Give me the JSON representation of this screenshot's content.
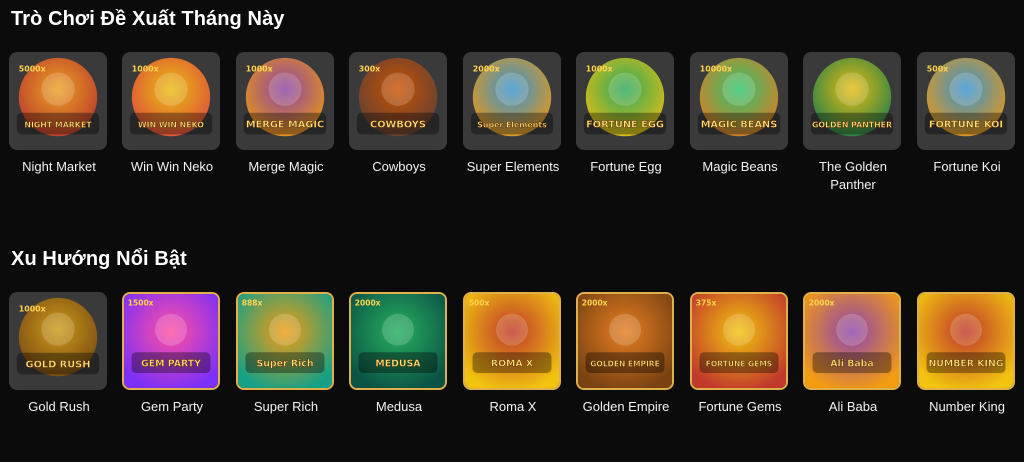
{
  "sections": [
    {
      "title": "Trò Chơi Đề Xuất Tháng Này",
      "games": [
        {
          "name": "Night Market",
          "logo": "NIGHT MARKET",
          "mult": "5000x",
          "colors": [
            "#f5a623",
            "#c0392b"
          ],
          "icon": "night-market-art"
        },
        {
          "name": "Win Win Neko",
          "logo": "WIN WIN NEKO",
          "mult": "1000x",
          "colors": [
            "#f1c40f",
            "#e74c3c"
          ],
          "icon": "neko-cat-art"
        },
        {
          "name": "Merge Magic",
          "logo": "MERGE MAGIC",
          "mult": "1000x",
          "colors": [
            "#8e44ad",
            "#f39c12"
          ],
          "icon": "merge-magic-art"
        },
        {
          "name": "Cowboys",
          "logo": "COWBOYS",
          "mult": "300x",
          "colors": [
            "#d35400",
            "#5d4037"
          ],
          "icon": "cowboys-art"
        },
        {
          "name": "Super Elements",
          "logo": "Super Elements",
          "mult": "2000x",
          "colors": [
            "#3498db",
            "#f39c12"
          ],
          "icon": "super-elements-art"
        },
        {
          "name": "Fortune Egg",
          "logo": "FORTUNE EGG",
          "mult": "1000x",
          "colors": [
            "#27ae60",
            "#f1c40f"
          ],
          "icon": "fortune-egg-art"
        },
        {
          "name": "Magic Beans",
          "logo": "MAGIC BEANS",
          "mult": "10000x",
          "colors": [
            "#2ecc71",
            "#e67e22"
          ],
          "icon": "magic-beans-art"
        },
        {
          "name": "The Golden Panther",
          "logo": "GOLDEN PANTHER",
          "mult": "",
          "colors": [
            "#f1c40f",
            "#1e824c"
          ],
          "icon": "golden-panther-art"
        },
        {
          "name": "Fortune Koi",
          "logo": "FORTUNE KOI",
          "mult": "500x",
          "colors": [
            "#3498db",
            "#f39c12"
          ],
          "icon": "fortune-koi-art"
        }
      ]
    },
    {
      "title": "Xu Hướng Nổi Bật",
      "games": [
        {
          "name": "Gold Rush",
          "logo": "GOLD RUSH",
          "mult": "1000x",
          "colors": [
            "#d4a017",
            "#7b4a12"
          ],
          "icon": "gold-rush-art"
        },
        {
          "name": "Gem Party",
          "logo": "GEM PARTY",
          "mult": "1500x",
          "colors": [
            "#ff4fa3",
            "#7b2ff7"
          ],
          "icon": "gem-party-art"
        },
        {
          "name": "Super Rich",
          "logo": "Super Rich",
          "mult": "888x",
          "colors": [
            "#f39c12",
            "#16a085"
          ],
          "icon": "super-rich-art"
        },
        {
          "name": "Medusa",
          "logo": "MEDUSA",
          "mult": "2000x",
          "colors": [
            "#27ae60",
            "#0b5345"
          ],
          "icon": "medusa-art"
        },
        {
          "name": "Roma X",
          "logo": "ROMA X",
          "mult": "500x",
          "colors": [
            "#c0392b",
            "#f1c40f"
          ],
          "icon": "roma-x-art"
        },
        {
          "name": "Golden Empire",
          "logo": "GOLDEN EMPIRE",
          "mult": "2000x",
          "colors": [
            "#e67e22",
            "#784212"
          ],
          "icon": "golden-empire-art"
        },
        {
          "name": "Fortune Gems",
          "logo": "FORTUNE GEMS",
          "mult": "375x",
          "colors": [
            "#f1c40f",
            "#c0392b"
          ],
          "icon": "fortune-gems-art"
        },
        {
          "name": "Ali Baba",
          "logo": "Ali Baba",
          "mult": "2000x",
          "colors": [
            "#8e44ad",
            "#f39c12"
          ],
          "icon": "ali-baba-art"
        },
        {
          "name": "Number King",
          "logo": "NUMBER KING",
          "mult": "",
          "colors": [
            "#c0392b",
            "#f1c40f"
          ],
          "icon": "number-king-art"
        }
      ]
    }
  ]
}
